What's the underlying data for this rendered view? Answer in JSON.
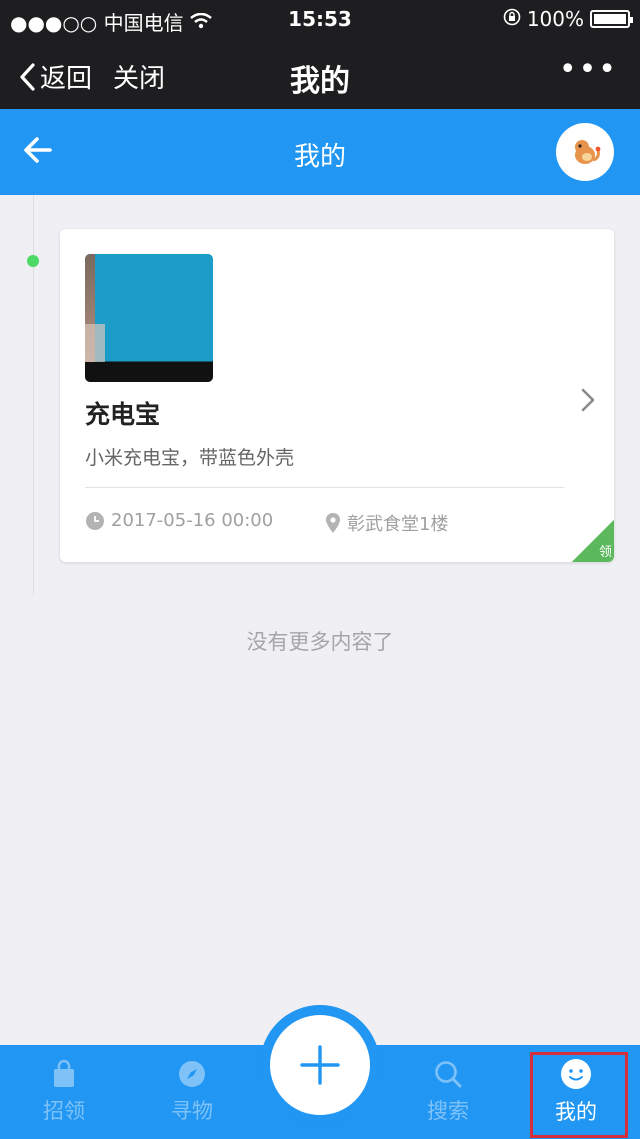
{
  "status_bar": {
    "carrier": "●●●○○ 中国电信",
    "time": "15:53",
    "battery": "100%"
  },
  "wechat_nav": {
    "back_label": "返回",
    "close_label": "关闭",
    "title": "我的",
    "more_label": "•••"
  },
  "header": {
    "title": "我的"
  },
  "items": [
    {
      "title": "充电宝",
      "description": "小米充电宝，带蓝色外壳",
      "time": "2017-05-16 00:00",
      "location": "彰武食堂1楼",
      "badge": "领"
    }
  ],
  "list_footer": "没有更多内容了",
  "tabbar": {
    "tabs": [
      {
        "label": "招领",
        "icon": "bag-icon"
      },
      {
        "label": "寻物",
        "icon": "compass-icon"
      },
      {
        "label": "搜索",
        "icon": "search-icon"
      },
      {
        "label": "我的",
        "icon": "smile-icon"
      }
    ],
    "add_icon": "plus-icon"
  },
  "colors": {
    "primary": "#2196f3",
    "timeline_dot": "#4cd964",
    "badge": "#5cb85c",
    "highlight_outline": "#d42f3a"
  }
}
